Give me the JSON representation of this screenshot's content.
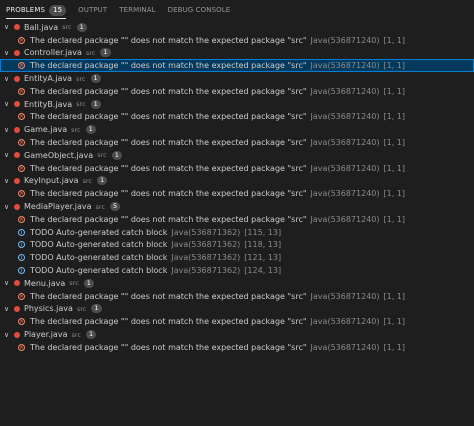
{
  "tabs": [
    {
      "label": "PROBLEMS",
      "badge": "15",
      "active": true
    },
    {
      "label": "OUTPUT",
      "badge": null,
      "active": false
    },
    {
      "label": "TERMINAL",
      "badge": null,
      "active": false
    },
    {
      "label": "DEBUG CONSOLE",
      "badge": null,
      "active": false
    }
  ],
  "colors": {
    "error": "#f48771",
    "info": "#75beff",
    "selection": "#04395e",
    "java_icon": "#e04d3e"
  },
  "files": [
    {
      "name": "Ball.java",
      "folder": "src",
      "count": "1",
      "problems": [
        {
          "severity": "error",
          "message": "The declared package \"\" does not match the expected package \"src\"",
          "source": "Java(536871240)",
          "location": "[1, 1]"
        }
      ]
    },
    {
      "name": "Controller.java",
      "folder": "src",
      "count": "1",
      "problems": [
        {
          "severity": "error",
          "message": "The declared package \"\" does not match the expected package \"src\"",
          "source": "Java(536871240)",
          "location": "[1, 1]",
          "selected": true
        }
      ]
    },
    {
      "name": "EntityA.java",
      "folder": "src",
      "count": "1",
      "problems": [
        {
          "severity": "error",
          "message": "The declared package \"\" does not match the expected package \"src\"",
          "source": "Java(536871240)",
          "location": "[1, 1]"
        }
      ]
    },
    {
      "name": "EntityB.java",
      "folder": "src",
      "count": "1",
      "problems": [
        {
          "severity": "error",
          "message": "The declared package \"\" does not match the expected package \"src\"",
          "source": "Java(536871240)",
          "location": "[1, 1]"
        }
      ]
    },
    {
      "name": "Game.java",
      "folder": "src",
      "count": "1",
      "problems": [
        {
          "severity": "error",
          "message": "The declared package \"\" does not match the expected package \"src\"",
          "source": "Java(536871240)",
          "location": "[1, 1]"
        }
      ]
    },
    {
      "name": "GameObject.java",
      "folder": "src",
      "count": "1",
      "problems": [
        {
          "severity": "error",
          "message": "The declared package \"\" does not match the expected package \"src\"",
          "source": "Java(536871240)",
          "location": "[1, 1]"
        }
      ]
    },
    {
      "name": "KeyInput.java",
      "folder": "src",
      "count": "1",
      "problems": [
        {
          "severity": "error",
          "message": "The declared package \"\" does not match the expected package \"src\"",
          "source": "Java(536871240)",
          "location": "[1, 1]"
        }
      ]
    },
    {
      "name": "MediaPlayer.java",
      "folder": "src",
      "count": "5",
      "problems": [
        {
          "severity": "error",
          "message": "The declared package \"\" does not match the expected package \"src\"",
          "source": "Java(536871240)",
          "location": "[1, 1]"
        },
        {
          "severity": "info",
          "message": "TODO Auto-generated catch block",
          "source": "Java(536871362)",
          "location": "[115, 13]"
        },
        {
          "severity": "info",
          "message": "TODO Auto-generated catch block",
          "source": "Java(536871362)",
          "location": "[118, 13]"
        },
        {
          "severity": "info",
          "message": "TODO Auto-generated catch block",
          "source": "Java(536871362)",
          "location": "[121, 13]"
        },
        {
          "severity": "info",
          "message": "TODO Auto-generated catch block",
          "source": "Java(536871362)",
          "location": "[124, 13]"
        }
      ]
    },
    {
      "name": "Menu.java",
      "folder": "src",
      "count": "1",
      "problems": [
        {
          "severity": "error",
          "message": "The declared package \"\" does not match the expected package \"src\"",
          "source": "Java(536871240)",
          "location": "[1, 1]"
        }
      ]
    },
    {
      "name": "Physics.java",
      "folder": "src",
      "count": "1",
      "problems": [
        {
          "severity": "error",
          "message": "The declared package \"\" does not match the expected package \"src\"",
          "source": "Java(536871240)",
          "location": "[1, 1]"
        }
      ]
    },
    {
      "name": "Player.java",
      "folder": "src",
      "count": "1",
      "problems": [
        {
          "severity": "error",
          "message": "The declared package \"\" does not match the expected package \"src\"",
          "source": "Java(536871240)",
          "location": "[1, 1]"
        }
      ]
    }
  ]
}
